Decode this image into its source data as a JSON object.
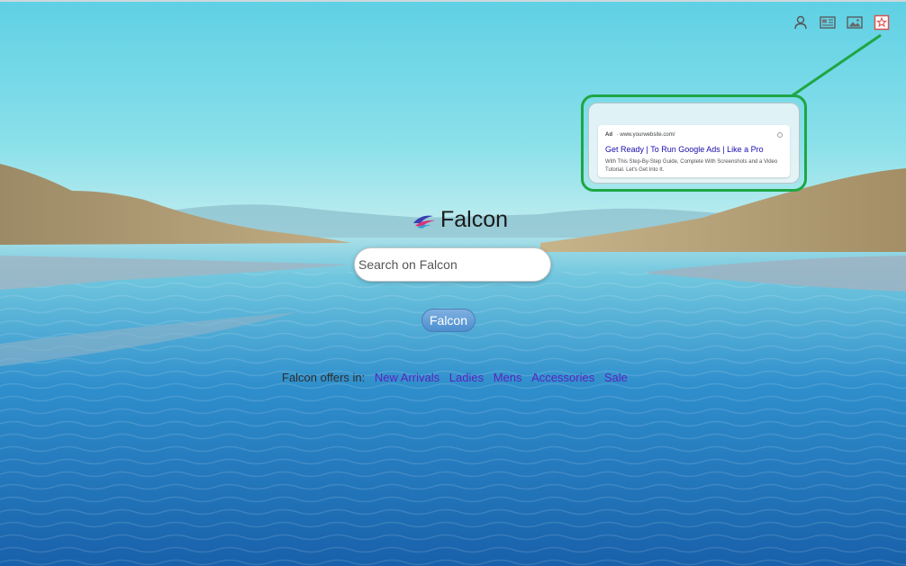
{
  "header": {
    "icons": [
      "user-icon",
      "news-icon",
      "image-icon",
      "bookmark-star-icon"
    ]
  },
  "ad_preview": {
    "badge": "Ad",
    "url": "· www.yourwebsite.com/",
    "headline": "Get Ready | To Run Google Ads | Like a Pro",
    "description": "With This Step-By-Step Guide, Complete With Screenshots and a Video Tutorial. Let's Get Into It.",
    "highlight_color": "#1fa645"
  },
  "logo": {
    "text": "Falcon"
  },
  "search": {
    "placeholder": "Search on Falcon",
    "button_label": "Falcon"
  },
  "offers": {
    "prefix": "Falcon offers in:",
    "links": [
      "New Arrivals",
      "Ladies",
      "Mens",
      "Accessories",
      "Sale"
    ],
    "link_color": "#5a22c2"
  }
}
